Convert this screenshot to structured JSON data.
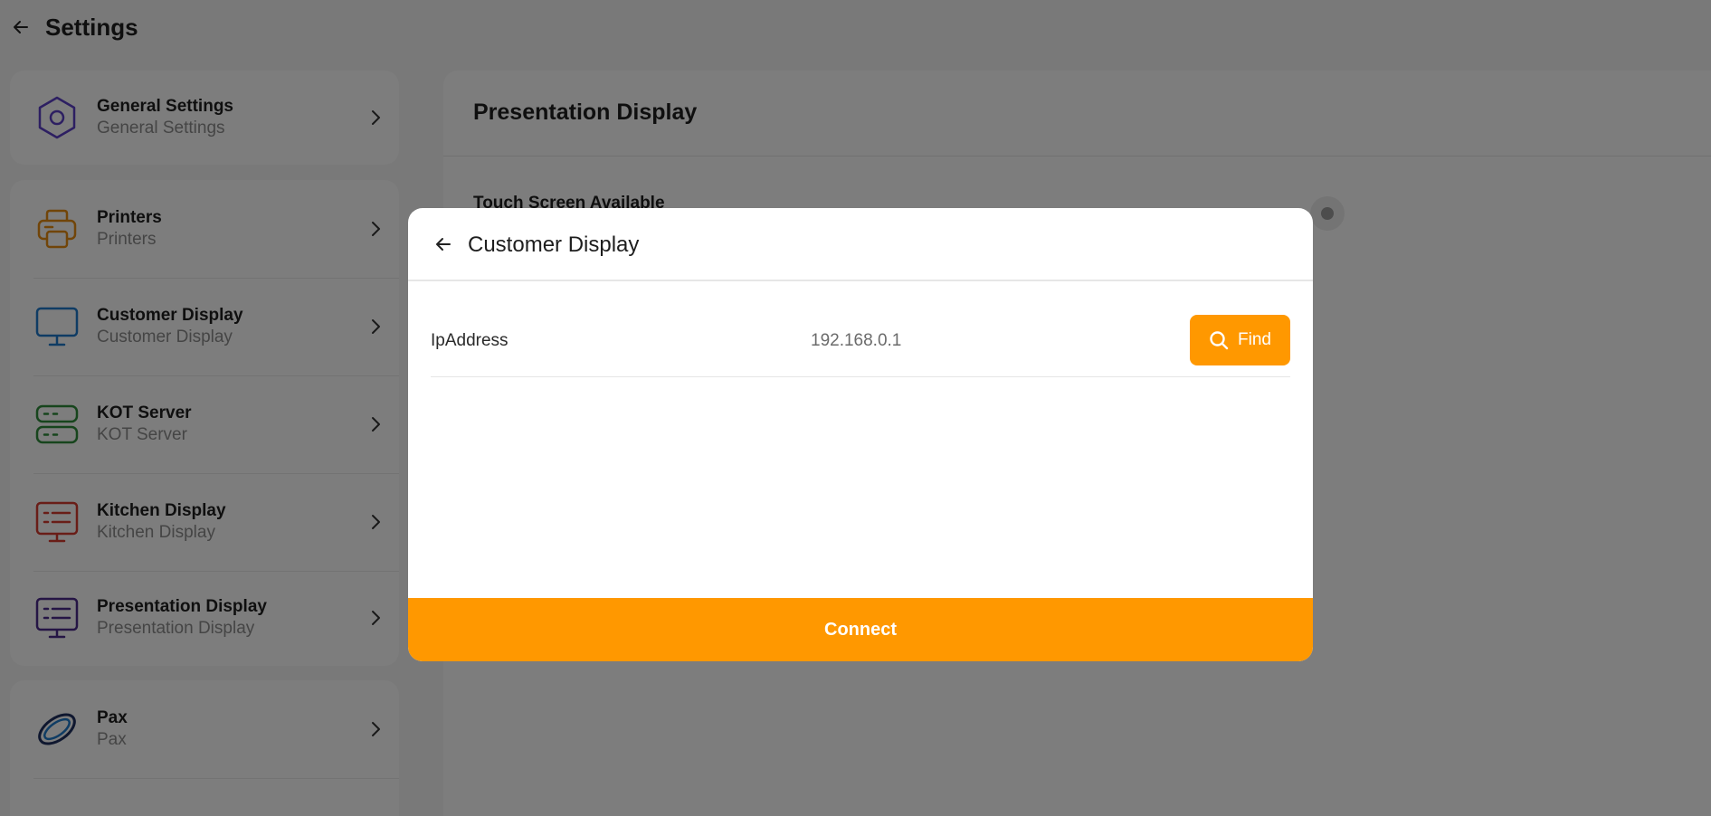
{
  "header": {
    "title": "Settings"
  },
  "sidebar": {
    "groups": [
      {
        "items": [
          {
            "title": "General Settings",
            "subtitle": "General Settings",
            "icon": "hexagon-settings-icon",
            "color": "#5b3fc4"
          }
        ]
      },
      {
        "items": [
          {
            "title": "Printers",
            "subtitle": "Printers",
            "icon": "printer-icon",
            "color": "#e38a12"
          },
          {
            "title": "Customer Display",
            "subtitle": "Customer Display",
            "icon": "monitor-icon",
            "color": "#1f78c8"
          },
          {
            "title": "KOT Server",
            "subtitle": "KOT Server",
            "icon": "server-icon",
            "color": "#2e8b3a"
          },
          {
            "title": "Kitchen Display",
            "subtitle": "Kitchen Display",
            "icon": "kitchen-display-icon",
            "color": "#d23a2f"
          },
          {
            "title": "Presentation Display",
            "subtitle": "Presentation Display",
            "icon": "presentation-display-icon",
            "color": "#4b2a8a"
          }
        ]
      },
      {
        "items": [
          {
            "title": "Pax",
            "subtitle": "Pax",
            "icon": "pax-icon",
            "color": "#1e2f5e"
          }
        ]
      }
    ]
  },
  "panel": {
    "title": "Presentation Display",
    "row_label": "Touch Screen Available"
  },
  "modal": {
    "title": "Customer Display",
    "ip_label": "IpAddress",
    "ip_value": "192.168.0.1",
    "find_label": "Find",
    "connect_label": "Connect",
    "accent_color": "#ff9800"
  }
}
